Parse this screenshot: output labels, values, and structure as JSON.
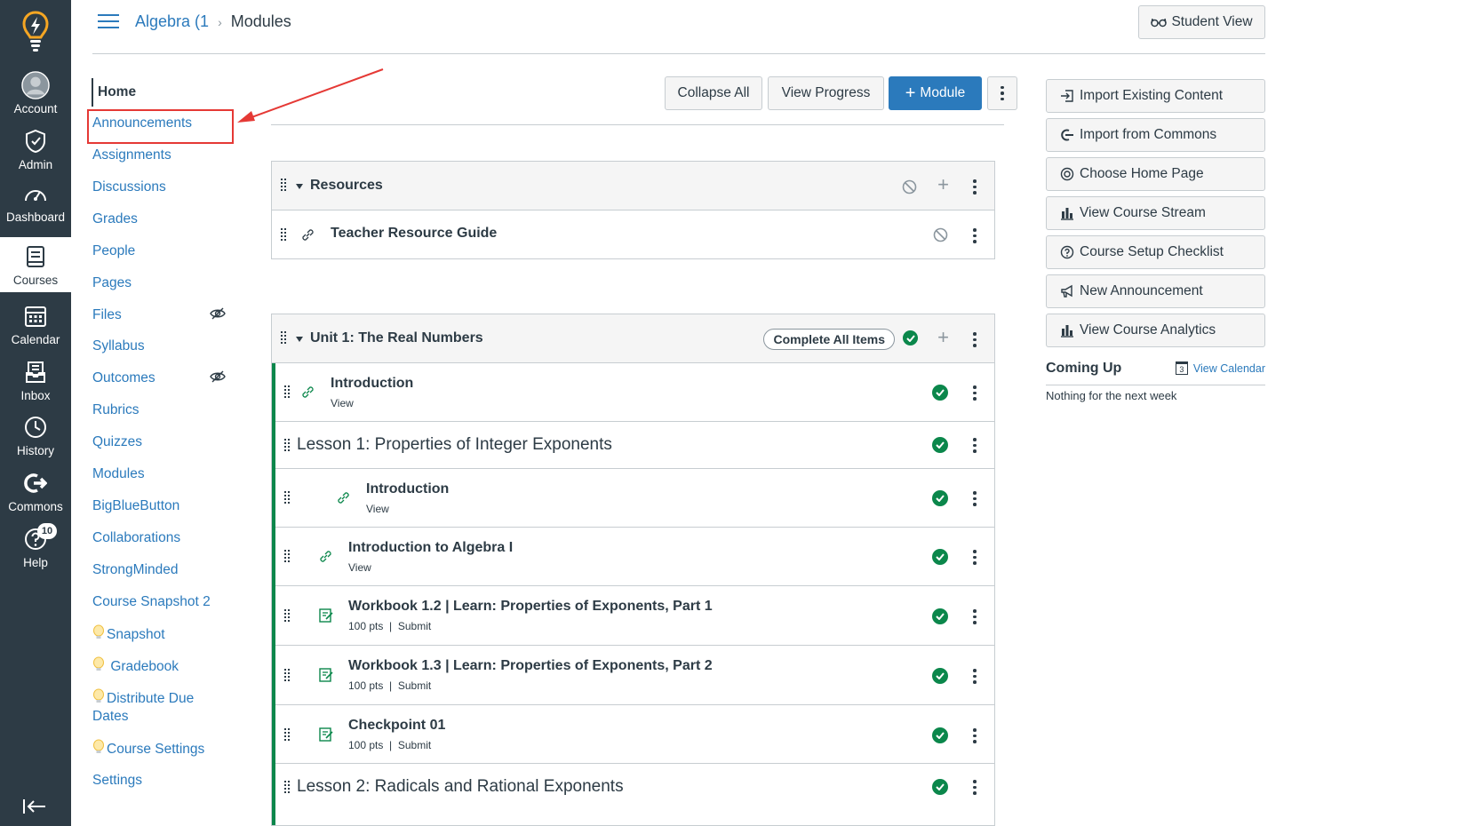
{
  "global_nav": {
    "items": [
      {
        "label": "Account",
        "icon": "account-icon"
      },
      {
        "label": "Admin",
        "icon": "admin-icon"
      },
      {
        "label": "Dashboard",
        "icon": "dashboard-icon"
      },
      {
        "label": "Courses",
        "icon": "courses-icon"
      },
      {
        "label": "Calendar",
        "icon": "calendar-icon"
      },
      {
        "label": "Inbox",
        "icon": "inbox-icon"
      },
      {
        "label": "History",
        "icon": "history-icon"
      },
      {
        "label": "Commons",
        "icon": "commons-icon"
      },
      {
        "label": "Help",
        "icon": "help-icon",
        "badge": "10"
      }
    ]
  },
  "header": {
    "breadcrumb_course": "Algebra (1",
    "breadcrumb_separator": "›",
    "breadcrumb_page": "Modules",
    "student_view": "Student View"
  },
  "course_nav": {
    "items": [
      {
        "label": "Home"
      },
      {
        "label": "Announcements"
      },
      {
        "label": "Assignments"
      },
      {
        "label": "Discussions"
      },
      {
        "label": "Grades"
      },
      {
        "label": "People"
      },
      {
        "label": "Pages"
      },
      {
        "label": "Files"
      },
      {
        "label": "Syllabus"
      },
      {
        "label": "Outcomes"
      },
      {
        "label": "Rubrics"
      },
      {
        "label": "Quizzes"
      },
      {
        "label": "Modules"
      },
      {
        "label": "BigBlueButton"
      },
      {
        "label": "Collaborations"
      },
      {
        "label": "StrongMinded"
      },
      {
        "label": "Course Snapshot 2"
      },
      {
        "label": "Snapshot"
      },
      {
        "label": "Gradebook"
      },
      {
        "label": "Distribute Due"
      },
      {
        "label": "Dates"
      },
      {
        "label": "Course Settings"
      },
      {
        "label": "Settings"
      }
    ]
  },
  "toolbar": {
    "collapse_all": "Collapse All",
    "view_progress": "View Progress",
    "add_module": "Module"
  },
  "modules": {
    "resources": {
      "title": "Resources",
      "items": [
        {
          "title": "Teacher Resource Guide"
        }
      ]
    },
    "unit1": {
      "title": "Unit 1: The Real Numbers",
      "complete_all": "Complete All Items",
      "items": [
        {
          "title": "Introduction",
          "meta": "View"
        },
        {
          "title": "Lesson 1: Properties of Integer Exponents"
        },
        {
          "title": "Introduction",
          "meta": "View"
        },
        {
          "title": "Introduction to Algebra I",
          "meta": "View"
        },
        {
          "title": "Workbook 1.2 | Learn: Properties of Exponents, Part 1",
          "pts": "100 pts",
          "sep": "|",
          "action": "Submit"
        },
        {
          "title": "Workbook 1.3 | Learn: Properties of Exponents, Part 2",
          "pts": "100 pts",
          "sep": "|",
          "action": "Submit"
        },
        {
          "title": "Checkpoint 01",
          "pts": "100 pts",
          "sep": "|",
          "action": "Submit"
        },
        {
          "title": "Lesson 2: Radicals and Rational Exponents"
        }
      ]
    }
  },
  "sidebar": {
    "buttons": [
      {
        "label": "Import Existing Content",
        "icon": "import-icon"
      },
      {
        "label": "Import from Commons",
        "icon": "commons-icon"
      },
      {
        "label": "Choose Home Page",
        "icon": "target-icon"
      },
      {
        "label": "View Course Stream",
        "icon": "bar-chart-icon"
      },
      {
        "label": "Course Setup Checklist",
        "icon": "question-icon"
      },
      {
        "label": "New Announcement",
        "icon": "megaphone-icon"
      },
      {
        "label": "View Course Analytics",
        "icon": "bar-chart-icon"
      }
    ],
    "coming_up": "Coming Up",
    "view_calendar": "View Calendar",
    "calendar_day": "3",
    "nothing": "Nothing for the next week"
  },
  "colors": {
    "nav_bg": "#2d3b45",
    "link": "#2b7abc",
    "primary": "#2b7abc",
    "success": "#0b874b",
    "highlight": "#e53935",
    "logo": "#f5a623"
  }
}
